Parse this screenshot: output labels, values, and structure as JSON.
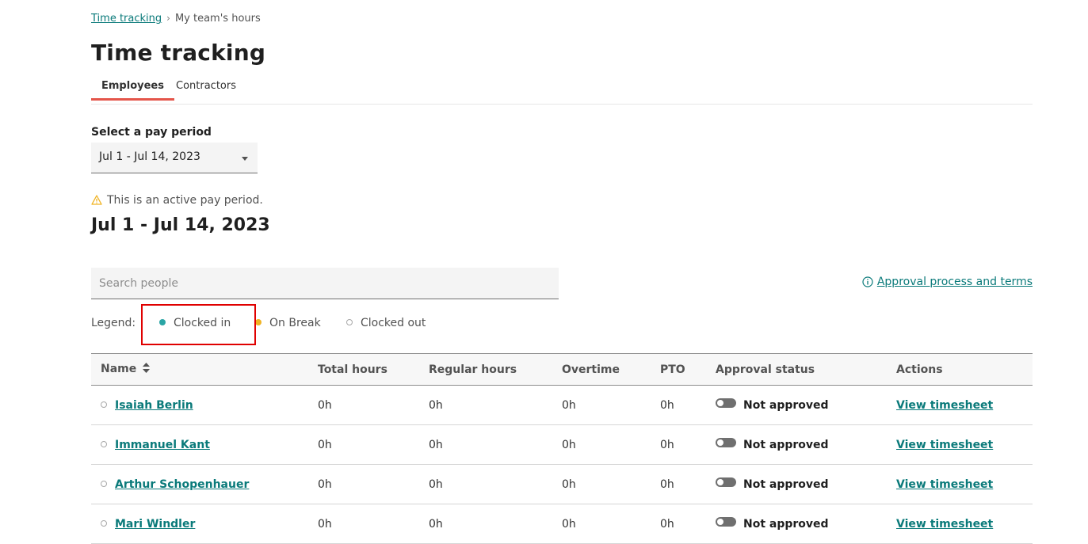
{
  "breadcrumb": {
    "parent": "Time tracking",
    "separator": "›",
    "current": "My team's hours"
  },
  "page_title": "Time tracking",
  "tabs": [
    {
      "label": "Employees",
      "active": true
    },
    {
      "label": "Contractors",
      "active": false
    }
  ],
  "pay_period": {
    "label": "Select a pay period",
    "selected": "Jul 1 - Jul 14, 2023"
  },
  "notice": {
    "icon": "warning-icon",
    "text": "This is an active pay period."
  },
  "period_heading": "Jul 1 - Jul 14, 2023",
  "search": {
    "placeholder": "Search people",
    "value": ""
  },
  "approval_link": {
    "icon": "info-icon",
    "label": "Approval process and terms"
  },
  "legend": {
    "label": "Legend:",
    "items": [
      {
        "label": "Clocked in",
        "color": "#2aa5a5"
      },
      {
        "label": "On Break",
        "color": "#f0b323"
      },
      {
        "label": "Clocked out",
        "color": "#ffffff"
      }
    ]
  },
  "table": {
    "columns": [
      "Name",
      "Total hours",
      "Regular hours",
      "Overtime",
      "PTO",
      "Approval status",
      "Actions"
    ],
    "rows": [
      {
        "name": "Isaiah Berlin",
        "total": "0h",
        "regular": "0h",
        "overtime": "0h",
        "pto": "0h",
        "status": "Not approved",
        "action": "View timesheet"
      },
      {
        "name": "Immanuel Kant",
        "total": "0h",
        "regular": "0h",
        "overtime": "0h",
        "pto": "0h",
        "status": "Not approved",
        "action": "View timesheet"
      },
      {
        "name": "Arthur Schopenhauer",
        "total": "0h",
        "regular": "0h",
        "overtime": "0h",
        "pto": "0h",
        "status": "Not approved",
        "action": "View timesheet"
      },
      {
        "name": "Mari Windler",
        "total": "0h",
        "regular": "0h",
        "overtime": "0h",
        "pto": "0h",
        "status": "Not approved",
        "action": "View timesheet"
      }
    ]
  },
  "colors": {
    "accent": "#0a7a7a",
    "tab_indicator": "#e4554a",
    "highlight": "#e00000"
  }
}
